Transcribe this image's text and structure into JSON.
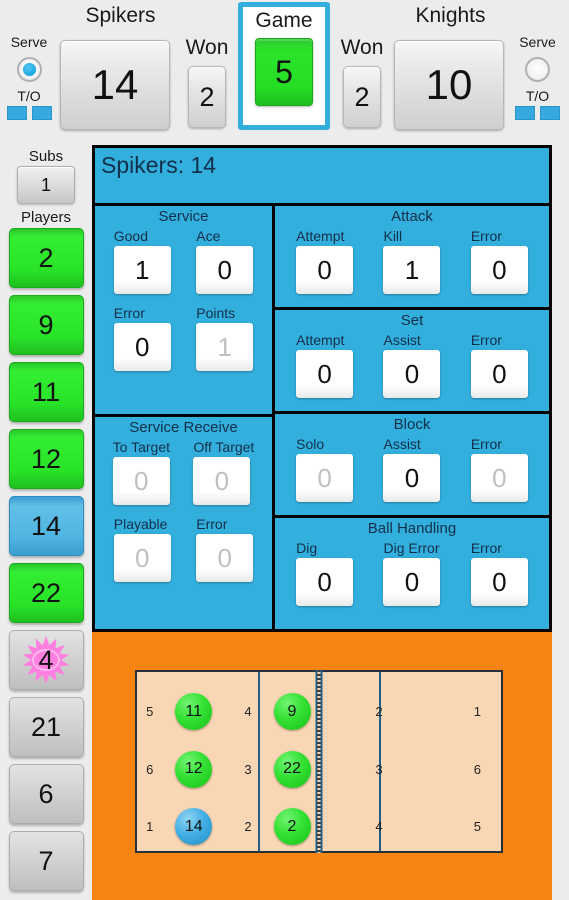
{
  "scoreboard": {
    "left": {
      "team": "Spikers",
      "score": "14",
      "won_label": "Won",
      "won": "2",
      "serve_label": "Serve",
      "serve_active": true,
      "timeout_label": "T/O",
      "timeouts": [
        "",
        ""
      ]
    },
    "right": {
      "team": "Knights",
      "score": "10",
      "won_label": "Won",
      "won": "2",
      "serve_label": "Serve",
      "serve_active": false,
      "timeout_label": "T/O",
      "timeouts": [
        "",
        ""
      ]
    },
    "game": {
      "label": "Game",
      "value": "5"
    }
  },
  "sidebar": {
    "subs_label": "Subs",
    "subs_count": "1",
    "players_label": "Players",
    "players": [
      {
        "number": "2",
        "state": "green",
        "libero": false
      },
      {
        "number": "9",
        "state": "green",
        "libero": false
      },
      {
        "number": "11",
        "state": "green",
        "libero": false
      },
      {
        "number": "12",
        "state": "green",
        "libero": false
      },
      {
        "number": "14",
        "state": "blue",
        "libero": false
      },
      {
        "number": "22",
        "state": "green",
        "libero": false
      },
      {
        "number": "4",
        "state": "grey",
        "libero": true
      },
      {
        "number": "21",
        "state": "grey",
        "libero": false
      },
      {
        "number": "6",
        "state": "grey",
        "libero": false
      },
      {
        "number": "7",
        "state": "grey",
        "libero": false
      }
    ]
  },
  "stats": {
    "header": "Spikers: 14",
    "groups": {
      "service": {
        "title": "Service",
        "row1": [
          {
            "label": "Good",
            "value": "1",
            "dim": false
          },
          {
            "label": "Ace",
            "value": "0",
            "dim": false
          }
        ],
        "row2": [
          {
            "label": "Error",
            "value": "0",
            "dim": false
          },
          {
            "label": "Points",
            "value": "1",
            "dim": true
          }
        ]
      },
      "service_receive": {
        "title": "Service Receive",
        "row1": [
          {
            "label": "To Target",
            "value": "0",
            "dim": true
          },
          {
            "label": "Off Target",
            "value": "0",
            "dim": true
          }
        ],
        "row2": [
          {
            "label": "Playable",
            "value": "0",
            "dim": true
          },
          {
            "label": "Error",
            "value": "0",
            "dim": true
          }
        ]
      },
      "attack": {
        "title": "Attack",
        "fields": [
          {
            "label": "Attempt",
            "value": "0",
            "dim": false
          },
          {
            "label": "Kill",
            "value": "1",
            "dim": false
          },
          {
            "label": "Error",
            "value": "0",
            "dim": false
          }
        ]
      },
      "set": {
        "title": "Set",
        "fields": [
          {
            "label": "Attempt",
            "value": "0",
            "dim": false
          },
          {
            "label": "Assist",
            "value": "0",
            "dim": false
          },
          {
            "label": "Error",
            "value": "0",
            "dim": false
          }
        ]
      },
      "block": {
        "title": "Block",
        "fields": [
          {
            "label": "Solo",
            "value": "0",
            "dim": true
          },
          {
            "label": "Assist",
            "value": "0",
            "dim": false
          },
          {
            "label": "Error",
            "value": "0",
            "dim": true
          }
        ]
      },
      "ball_handling": {
        "title": "Ball Handling",
        "fields": [
          {
            "label": "Dig",
            "value": "0",
            "dim": false
          },
          {
            "label": "Dig Error",
            "value": "0",
            "dim": false
          },
          {
            "label": "Error",
            "value": "0",
            "dim": false
          }
        ]
      }
    }
  },
  "court": {
    "near_back": [
      {
        "position": "5",
        "player": "11",
        "state": "green"
      },
      {
        "position": "6",
        "player": "12",
        "state": "green"
      },
      {
        "position": "1",
        "player": "14",
        "state": "blue"
      }
    ],
    "near_front": [
      {
        "position": "4",
        "player": "9",
        "state": "green"
      },
      {
        "position": "3",
        "player": "22",
        "state": "green"
      },
      {
        "position": "2",
        "player": "2",
        "state": "green"
      }
    ],
    "far_front": [
      {
        "position": "2",
        "player": "",
        "state": ""
      },
      {
        "position": "3",
        "player": "",
        "state": ""
      },
      {
        "position": "4",
        "player": "",
        "state": ""
      }
    ],
    "far_back": [
      {
        "position": "1",
        "player": "",
        "state": ""
      },
      {
        "position": "6",
        "player": "",
        "state": ""
      },
      {
        "position": "5",
        "player": "",
        "state": ""
      }
    ]
  },
  "colors": {
    "panel_blue": "#33afde",
    "court_orange": "#f58413",
    "court_floor": "#fad7b4",
    "player_green": "#2ce32c",
    "player_blue": "#4fb4e2",
    "libero_pink": "#ff7fe0"
  }
}
